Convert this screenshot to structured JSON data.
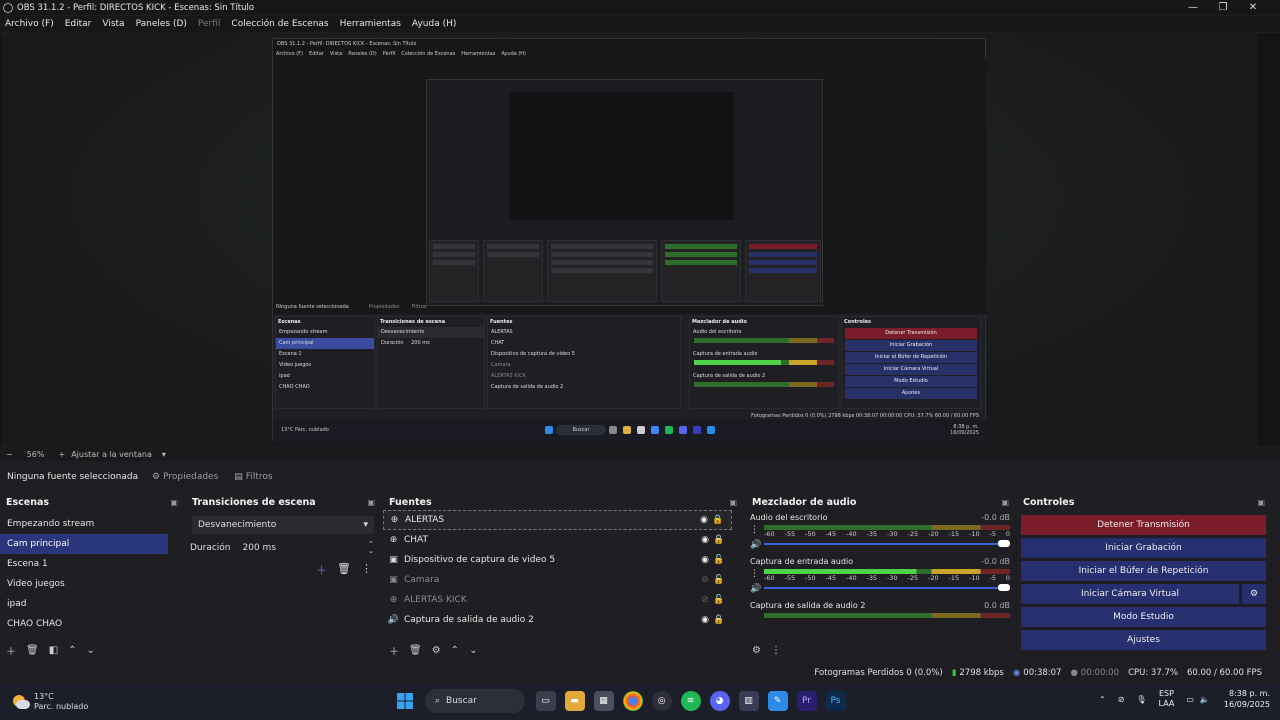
{
  "window": {
    "title": "OBS 31.1.2 - Perfil: DIRECTOS KICK - Escenas: Sin Título",
    "min": "—",
    "max": "❐",
    "close": "✕"
  },
  "menu": [
    "Archivo (F)",
    "Editar",
    "Vista",
    "Paneles (D)",
    "Perfil",
    "Colección de Escenas",
    "Herramientas",
    "Ayuda (H)"
  ],
  "nested_preview": {
    "title": "OBS 31.1.2 - Perfil: DIRECTOS KICK - Escenas: Sin Título",
    "menu": [
      "Archivo (F)",
      "Editar",
      "Vista",
      "Paneles (D)",
      "Perfil",
      "Colección de Escenas",
      "Herramientas",
      "Ayuda (H)"
    ],
    "no_source": "Ninguna fuente seleccionada",
    "props": "Propiedades",
    "filters": "Filtros",
    "scenes_h": "Escenas",
    "scenes": [
      "Empezando stream",
      "Cam principal",
      "Escena 1",
      "Video juegos",
      "ipad",
      "CHAO CHAO"
    ],
    "trans_h": "Transiciones de escena",
    "trans": "Desvanecimiento",
    "dur_label": "Duración",
    "dur": "200 ms",
    "sources_h": "Fuentes",
    "sources": [
      "ALERTAS",
      "CHAT",
      "Dispositivo de captura de video 5",
      "Camara",
      "ALERTAS KICK",
      "Captura de salida de audio 2"
    ],
    "mixer_h": "Mezclador de audio",
    "mixer": [
      "Audio del escritorio",
      "Captura de entrada audio",
      "Captura de salida de audio 2"
    ],
    "controls_h": "Controles",
    "controls": [
      "Detener Transmisión",
      "Iniciar Grabación",
      "Iniciar el Búfer de Repetición",
      "Iniciar Cámara Virtual",
      "Modo Estudio",
      "Ajustes"
    ],
    "status": "Fotogramas Perdidos 0 (0.0%)   2798 kbps   00:38:07   00:00:00   CPU: 37.7%   60.00 / 60.00 FPS",
    "weather": "13°C Parc. nublado",
    "search": "Buscar",
    "time": "8:38 p. m.",
    "date": "16/09/2025"
  },
  "zoom": {
    "minus": "−",
    "value": "56%",
    "plus": "+",
    "fit": "Ajustar a la ventana",
    "arrow": "▾"
  },
  "propbar": {
    "no_source": "Ninguna fuente seleccionada",
    "properties": "Propiedades",
    "filters": "Filtros"
  },
  "scenes": {
    "title": "Escenas",
    "items": [
      {
        "label": "Empezando stream",
        "selected": false
      },
      {
        "label": "Cam principal",
        "selected": true
      },
      {
        "label": "Escena 1",
        "selected": false
      },
      {
        "label": "Video juegos",
        "selected": false
      },
      {
        "label": "ipad",
        "selected": false
      },
      {
        "label": "CHAO CHAO",
        "selected": false
      }
    ]
  },
  "transitions": {
    "title": "Transiciones de escena",
    "selected": "Desvanecimiento",
    "duration_label": "Duración",
    "duration": "200 ms"
  },
  "sources": {
    "title": "Fuentes",
    "items": [
      {
        "label": "ALERTAS",
        "icon": "browser-icon",
        "visible": true,
        "locked": true
      },
      {
        "label": "CHAT",
        "icon": "browser-icon",
        "visible": true,
        "locked": true
      },
      {
        "label": "Dispositivo de captura de video 5",
        "icon": "camera-icon",
        "visible": true,
        "locked": false
      },
      {
        "label": "Camara",
        "icon": "camera-icon",
        "visible": false,
        "locked": false
      },
      {
        "label": "ALERTAS KICK",
        "icon": "browser-icon",
        "visible": false,
        "locked": false
      },
      {
        "label": "Captura de salida de audio 2",
        "icon": "speaker-icon",
        "visible": true,
        "locked": true
      }
    ]
  },
  "mixer": {
    "title": "Mezclador de audio",
    "channels": [
      {
        "name": "Audio del escritorio",
        "db": "-0.0 dB",
        "active": false
      },
      {
        "name": "Captura de entrada audio",
        "db": "-0.0 dB",
        "active": true
      },
      {
        "name": "Captura de salida de audio 2",
        "db": "0.0 dB",
        "active": false
      }
    ],
    "ticks": [
      "-60",
      "-55",
      "-50",
      "-45",
      "-40",
      "-35",
      "-30",
      "-25",
      "-20",
      "-15",
      "-10",
      "-5",
      "0"
    ]
  },
  "controls": {
    "title": "Controles",
    "stop_stream": "Detener Transmisión",
    "start_record": "Iniciar Grabación",
    "replay": "Iniciar el Búfer de Repetición",
    "virtual_cam": "Iniciar Cámara Virtual",
    "studio": "Modo Estudio",
    "settings": "Ajustes"
  },
  "status": {
    "dropped": "Fotogramas Perdidos 0 (0.0%)",
    "bitrate": "2798 kbps",
    "stream_time": "00:38:07",
    "rec_time": "00:00:00",
    "cpu": "CPU: 37.7%",
    "fps": "60.00 / 60.00 FPS"
  },
  "taskbar": {
    "temp": "13°C",
    "weather": "Parc. nublado",
    "search": "Buscar",
    "lang1": "ESP",
    "lang2": "LAA",
    "time": "8:38 p. m.",
    "date": "16/09/2025"
  },
  "colors": {
    "accent": "#29367c",
    "stop": "#7c1d2c",
    "button": "#263070",
    "meter_green": "#4fd14a"
  }
}
